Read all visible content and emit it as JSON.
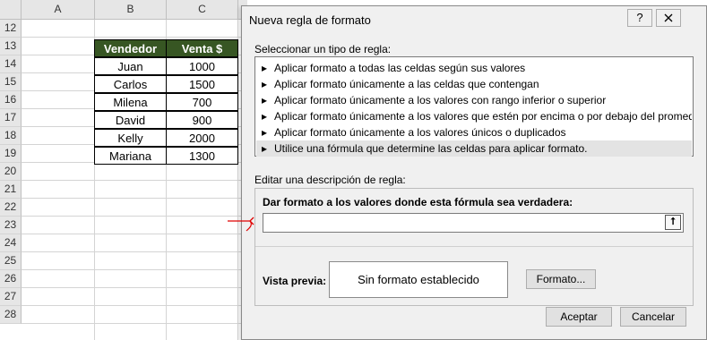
{
  "sheet": {
    "columns": [
      "A",
      "B",
      "C"
    ],
    "rows": [
      "12",
      "13",
      "14",
      "15",
      "16",
      "17",
      "18",
      "19",
      "20",
      "21",
      "22",
      "23",
      "24",
      "25",
      "26",
      "27",
      "28"
    ],
    "table": {
      "headers": [
        "Vendedor",
        "Venta $"
      ],
      "rows": [
        [
          "Juan",
          "1000"
        ],
        [
          "Carlos",
          "1500"
        ],
        [
          "Milena",
          "700"
        ],
        [
          "David",
          "900"
        ],
        [
          "Kelly",
          "2000"
        ],
        [
          "Mariana",
          "1300"
        ]
      ],
      "header_color": "#375623"
    }
  },
  "dialog": {
    "title": "Nueva regla de formato",
    "help_button": "?",
    "close_icon": "close-icon",
    "select_type_label": "Seleccionar un tipo de regla:",
    "rule_arrow": "▸",
    "rule_types": [
      "Aplicar formato a todas las celdas según sus valores",
      "Aplicar formato únicamente a las celdas que contengan",
      "Aplicar formato únicamente a los valores con rango inferior o superior",
      "Aplicar formato únicamente a los valores que estén por encima o por debajo del promedio",
      "Aplicar formato únicamente a los valores únicos o duplicados",
      "Utilice una fórmula que determine las celdas para aplicar formato."
    ],
    "selected_rule_index": 5,
    "edit_desc_label": "Editar una descripción de regla:",
    "formula_label": "Dar formato a los valores donde esta fórmula sea verdadera:",
    "formula_value": "",
    "collapse_glyph": "⭡",
    "preview_label": "Vista previa:",
    "preview_text": "Sin formato establecido",
    "format_button": "Formato...",
    "accept_button": "Aceptar",
    "cancel_button": "Cancelar"
  }
}
